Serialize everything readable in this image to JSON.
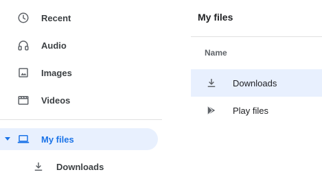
{
  "sidebar": {
    "items": [
      {
        "label": "Recent",
        "icon": "clock-icon"
      },
      {
        "label": "Audio",
        "icon": "headphones-icon"
      },
      {
        "label": "Images",
        "icon": "image-icon"
      },
      {
        "label": "Videos",
        "icon": "film-icon"
      },
      {
        "label": "My files",
        "icon": "laptop-icon",
        "selected": true,
        "expanded": true
      },
      {
        "label": "Downloads",
        "icon": "download-icon"
      }
    ]
  },
  "main": {
    "title": "My files",
    "column_header": "Name",
    "rows": [
      {
        "label": "Downloads",
        "icon": "download-icon",
        "selected": true
      },
      {
        "label": "Play files",
        "icon": "play-store-icon"
      }
    ]
  },
  "colors": {
    "accent": "#1a73e8",
    "selected_bg": "#e8f0fe",
    "icon": "#5f6368",
    "text": "#3c4043"
  }
}
